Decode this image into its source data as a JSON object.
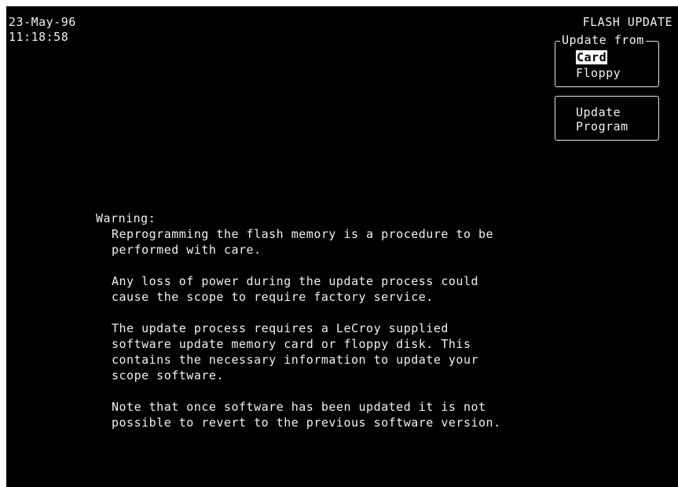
{
  "status": {
    "date": "23-May-96",
    "time": "11:18:58"
  },
  "menu": {
    "title": "FLASH UPDATE",
    "update_from": {
      "label": "Update from",
      "options": [
        "Card",
        "Floppy"
      ],
      "selected": "Card"
    },
    "update_program": {
      "line1": "Update",
      "line2": "Program"
    }
  },
  "warning": {
    "heading": "Warning:",
    "paragraphs": [
      "Reprogramming the flash memory is a procedure to be\nperformed with care.",
      "Any loss of power during the update process could\ncause the scope to require factory service.",
      "The update process requires a LeCroy supplied\nsoftware update memory card or floppy disk. This\ncontains the necessary information to update your\nscope software.",
      "Note that once software has been updated it is not\npossible to revert to the previous software version."
    ]
  },
  "colors": {
    "screen_background": "#000000",
    "text": "#f0f0f0",
    "selection_background": "#ffffff",
    "selection_text": "#000000"
  }
}
